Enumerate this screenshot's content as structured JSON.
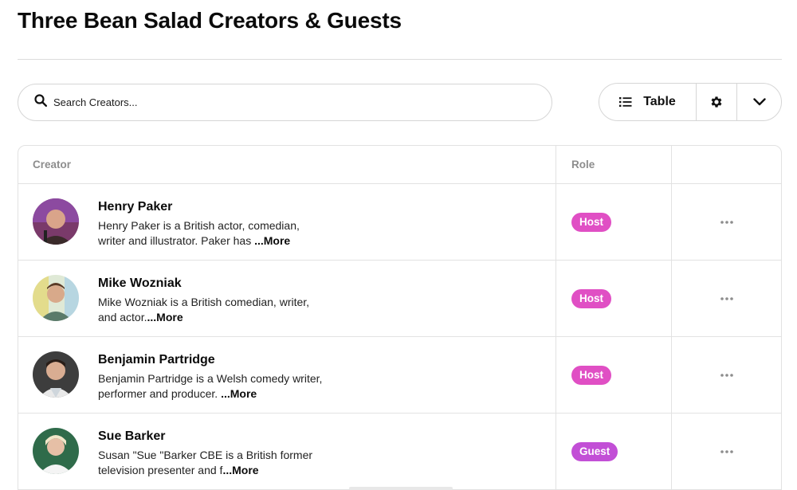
{
  "page": {
    "title": "Three Bean Salad Creators & Guests"
  },
  "search": {
    "placeholder": "Search Creators...",
    "icon": "search-icon"
  },
  "view_controls": {
    "view_label": "Table",
    "view_icon": "list-icon",
    "settings_icon": "gear-icon",
    "dropdown_icon": "chevron-down-icon"
  },
  "table": {
    "columns": [
      "Creator",
      "Role",
      ""
    ],
    "rows": [
      {
        "name": "Henry Paker",
        "bio": "Henry Paker is a British actor, comedian, writer and illustrator. Paker has ",
        "more": "...More",
        "role": "Host"
      },
      {
        "name": "Mike Wozniak",
        "bio": "Mike Wozniak is a British comedian, writer, and actor.",
        "more": "...More",
        "role": "Host"
      },
      {
        "name": "Benjamin Partridge",
        "bio": "Benjamin Partridge is a Welsh comedy writer, performer and producer. ",
        "more": "...More",
        "role": "Host"
      },
      {
        "name": "Sue Barker",
        "bio": "Susan \"Sue \"Barker CBE is a British former television presenter and f",
        "more": "...More",
        "role": "Guest"
      }
    ]
  },
  "colors": {
    "host_badge": "#e04fc4",
    "guest_badge": "#c24fd6",
    "text": "#111111",
    "muted": "#8d8d8d",
    "border": "#e2e2e2"
  }
}
